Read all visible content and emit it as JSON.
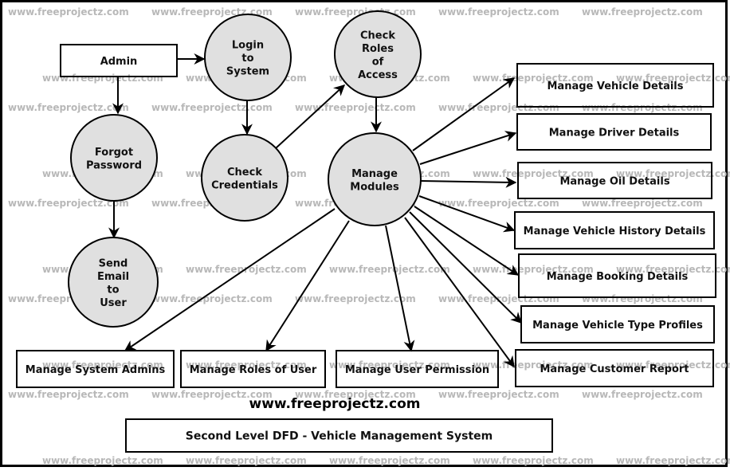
{
  "diagram": {
    "title": "Second Level DFD - Vehicle Management System",
    "website": "www.freeprojectz.com",
    "watermark": "www.freeprojectz.com",
    "colors": {
      "process_fill": "#e0e0e0",
      "stroke": "#000000",
      "watermark": "#b8b8b8"
    },
    "entities": {
      "admin": "Admin"
    },
    "processes": {
      "login": [
        "Login",
        "to",
        "System"
      ],
      "check_roles": [
        "Check",
        "Roles",
        "of",
        "Access"
      ],
      "forgot_password": [
        "Forgot",
        "Password"
      ],
      "check_credentials": [
        "Check",
        "Credentials"
      ],
      "manage_modules": [
        "Manage",
        "Modules"
      ],
      "send_email": [
        "Send",
        "Email",
        "to",
        "User"
      ]
    },
    "modules": [
      "Manage Vehicle Details",
      "Manage Driver Details",
      "Manage Oil Details",
      "Manage Vehicle History Details",
      "Manage Booking Details",
      "Manage Vehicle Type Profiles",
      "Manage Customer Report",
      "Manage System Admins",
      "Manage Roles of User",
      "Manage User Permission"
    ],
    "flows": [
      [
        "Admin",
        "Login to System"
      ],
      [
        "Admin",
        "Forgot Password"
      ],
      [
        "Login to System",
        "Check Credentials"
      ],
      [
        "Check Credentials",
        "Check Roles of Access"
      ],
      [
        "Check Roles of Access",
        "Manage Modules"
      ],
      [
        "Forgot Password",
        "Send Email to User"
      ],
      [
        "Manage Modules",
        "Manage Vehicle Details"
      ],
      [
        "Manage Modules",
        "Manage Driver Details"
      ],
      [
        "Manage Modules",
        "Manage Oil Details"
      ],
      [
        "Manage Modules",
        "Manage Vehicle History Details"
      ],
      [
        "Manage Modules",
        "Manage Booking Details"
      ],
      [
        "Manage Modules",
        "Manage Vehicle Type Profiles"
      ],
      [
        "Manage Modules",
        "Manage Customer Report"
      ],
      [
        "Manage Modules",
        "Manage System Admins"
      ],
      [
        "Manage Modules",
        "Manage Roles of User"
      ],
      [
        "Manage Modules",
        "Manage User Permission"
      ]
    ]
  }
}
